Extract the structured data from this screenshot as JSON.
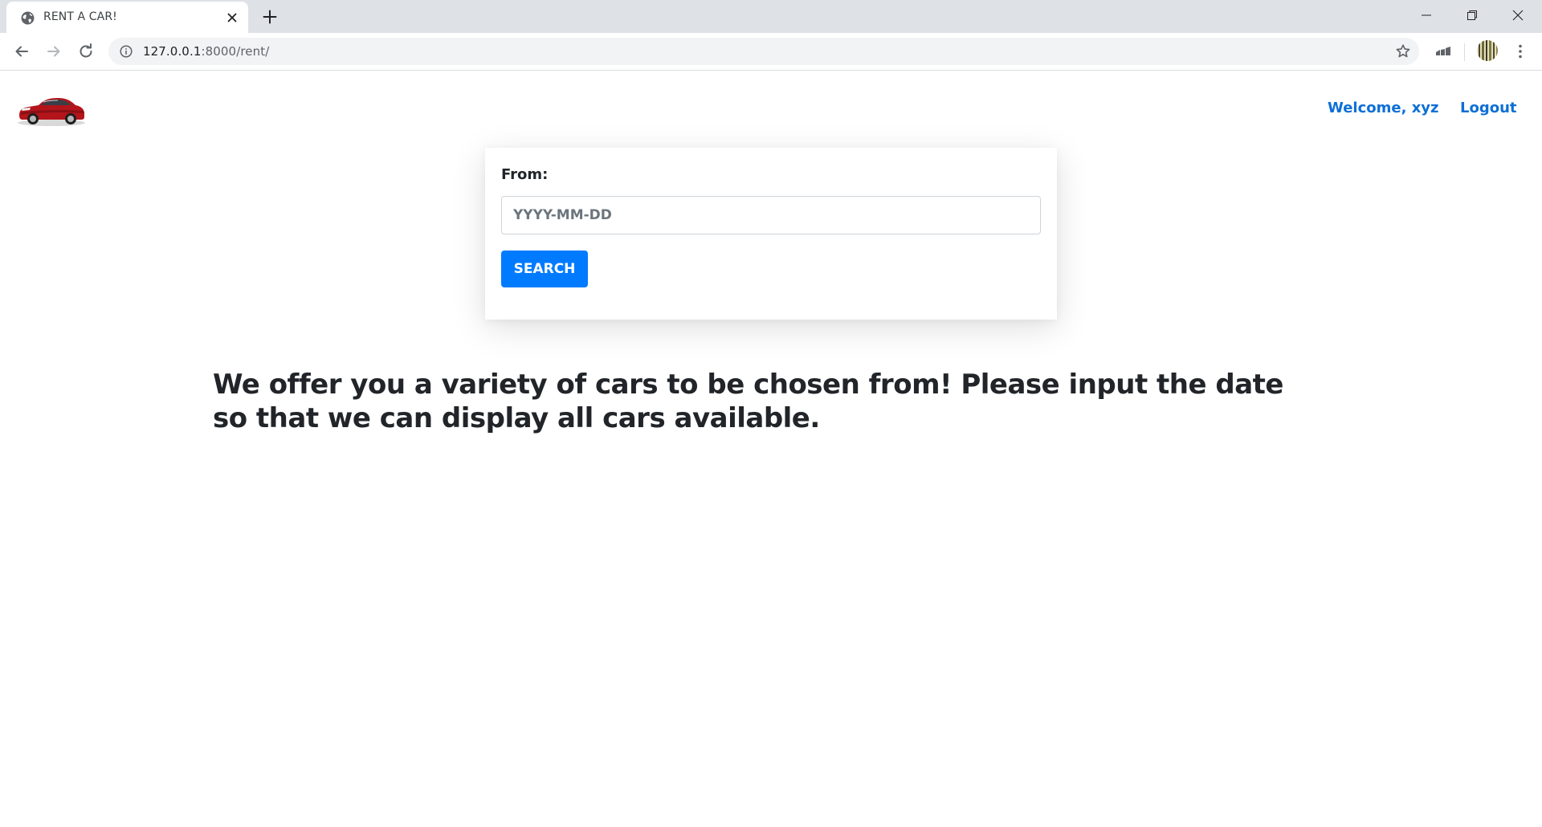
{
  "browser": {
    "tab": {
      "title": "RENT A CAR!",
      "favicon": "globe-icon"
    },
    "address_bar": {
      "host": "127.0.0.1",
      "path": ":8000/rent/",
      "info_icon": "info-icon"
    },
    "window_controls": [
      "minimize-icon",
      "restore-icon",
      "close-icon"
    ]
  },
  "header": {
    "logo": "red-car-logo",
    "welcome_link": "Welcome, xyz",
    "logout_link": "Logout",
    "link_color": "#0d6fd6"
  },
  "search_form": {
    "from_label": "From:",
    "date_placeholder": "YYYY-MM-DD",
    "date_value": "",
    "search_button": "SEARCH",
    "button_color": "#007bff"
  },
  "main": {
    "tagline": "We offer you a variety of cars to be chosen from! Please input the date so that we can display all cars available."
  }
}
